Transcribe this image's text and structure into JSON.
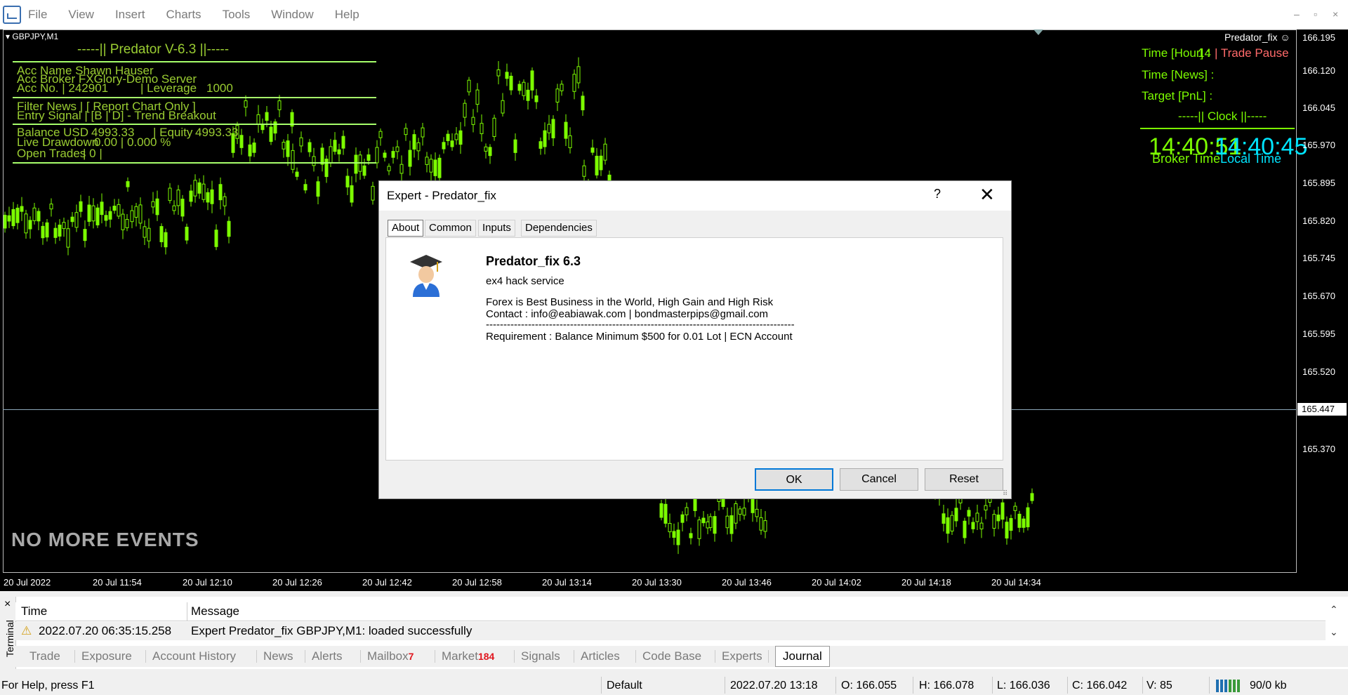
{
  "menu": {
    "items": [
      "File",
      "View",
      "Insert",
      "Charts",
      "Tools",
      "Window",
      "Help"
    ],
    "controls": {
      "minimize": "–",
      "restore": "▫",
      "close": "×"
    }
  },
  "chart": {
    "symbol": "GBPJPY,M1",
    "ea_label": "Predator_fix",
    "price_labels": [
      "166.195",
      "166.120",
      "166.045",
      "165.970",
      "165.895",
      "165.820",
      "165.745",
      "165.670",
      "165.595",
      "165.520",
      "165.370"
    ],
    "current_price": "165.447",
    "time_labels": [
      "20 Jul 2022",
      "20 Jul 11:54",
      "20 Jul 12:10",
      "20 Jul 12:26",
      "20 Jul 12:42",
      "20 Jul 12:58",
      "20 Jul 13:14",
      "20 Jul 13:30",
      "20 Jul 13:46",
      "20 Jul 14:02",
      "20 Jul 14:18",
      "20 Jul 14:34"
    ],
    "candle_color": "#7cfc00",
    "background": "#000000"
  },
  "overlay": {
    "title": "-----|| Predator V-6.3 ||-----",
    "acc_name": "Acc Name  Shawn Hauser",
    "acc_broker": "Acc Broker  FXGlory-Demo Server",
    "acc_no": "Acc No.   |  242901",
    "leverage": "| Leverage",
    "leverage_val": "1000",
    "filter_news": "Filter News   |  [ Report Chart Only ]",
    "entry_signal": "Entry Signal  | [B | D] - Trend Breakout",
    "balance": "Balance USD",
    "balance_val": "4993.33",
    "equity": "| Equity",
    "equity_val": "4993.33",
    "drawdown": "Live Drawdown",
    "drawdown_val": "0.00  |  0.000 %",
    "open_trades": "Open Trades",
    "open_trades_val": "| 0  |",
    "no_events": "NO MORE EVENTS"
  },
  "right_panel": {
    "time_hour": "Time [Hour]  :",
    "time_hour_val": "14",
    "trade_pause": "| Trade Pause",
    "time_news": "Time [News]  :",
    "target_pnl": "Target [PnL]  :",
    "clock_title": "-----|| Clock ||-----",
    "broker_time": "14:40:51",
    "local_time": "14:40:45",
    "broker_label": "Broker Time",
    "local_label": "Local Time"
  },
  "dialog": {
    "title": "Expert - Predator_fix",
    "help": "?",
    "close": "✕",
    "tabs": [
      "About",
      "Common",
      "Inputs",
      "Dependencies"
    ],
    "about": {
      "name": "Predator_fix 6.3",
      "subtitle": "ex4 hack service",
      "line1": "Forex is Best Business in the World, High Gain and High Risk",
      "line2": "Contact : info@eabiawak.com | bondmasterpips@gmail.com",
      "line3": "----------------------------------------------------------------------------------------",
      "line4": "Requirement : Balance Minimum $500 for 0.01 Lot | ECN Account"
    },
    "buttons": {
      "ok": "OK",
      "cancel": "Cancel",
      "reset": "Reset"
    }
  },
  "terminal": {
    "side_label": "Terminal",
    "close": "×",
    "headers": {
      "time": "Time",
      "message": "Message"
    },
    "rows": [
      {
        "time": "2022.07.20 06:35:15.258",
        "message": "Expert Predator_fix GBPJPY,M1: loaded successfully"
      }
    ],
    "tabs": [
      {
        "label": "Trade"
      },
      {
        "label": "Exposure"
      },
      {
        "label": "Account History"
      },
      {
        "label": "News"
      },
      {
        "label": "Alerts"
      },
      {
        "label": "Mailbox",
        "badge": "7"
      },
      {
        "label": "Market",
        "badge": "184"
      },
      {
        "label": "Signals"
      },
      {
        "label": "Articles"
      },
      {
        "label": "Code Base"
      },
      {
        "label": "Experts"
      },
      {
        "label": "Journal"
      }
    ]
  },
  "status": {
    "help": "For Help, press F1",
    "profile": "Default",
    "datetime": "2022.07.20 13:18",
    "open": "O: 166.055",
    "high": "H: 166.078",
    "low": "L: 166.036",
    "close": "C: 166.042",
    "volume": "V: 85",
    "traffic": "90/0 kb"
  }
}
